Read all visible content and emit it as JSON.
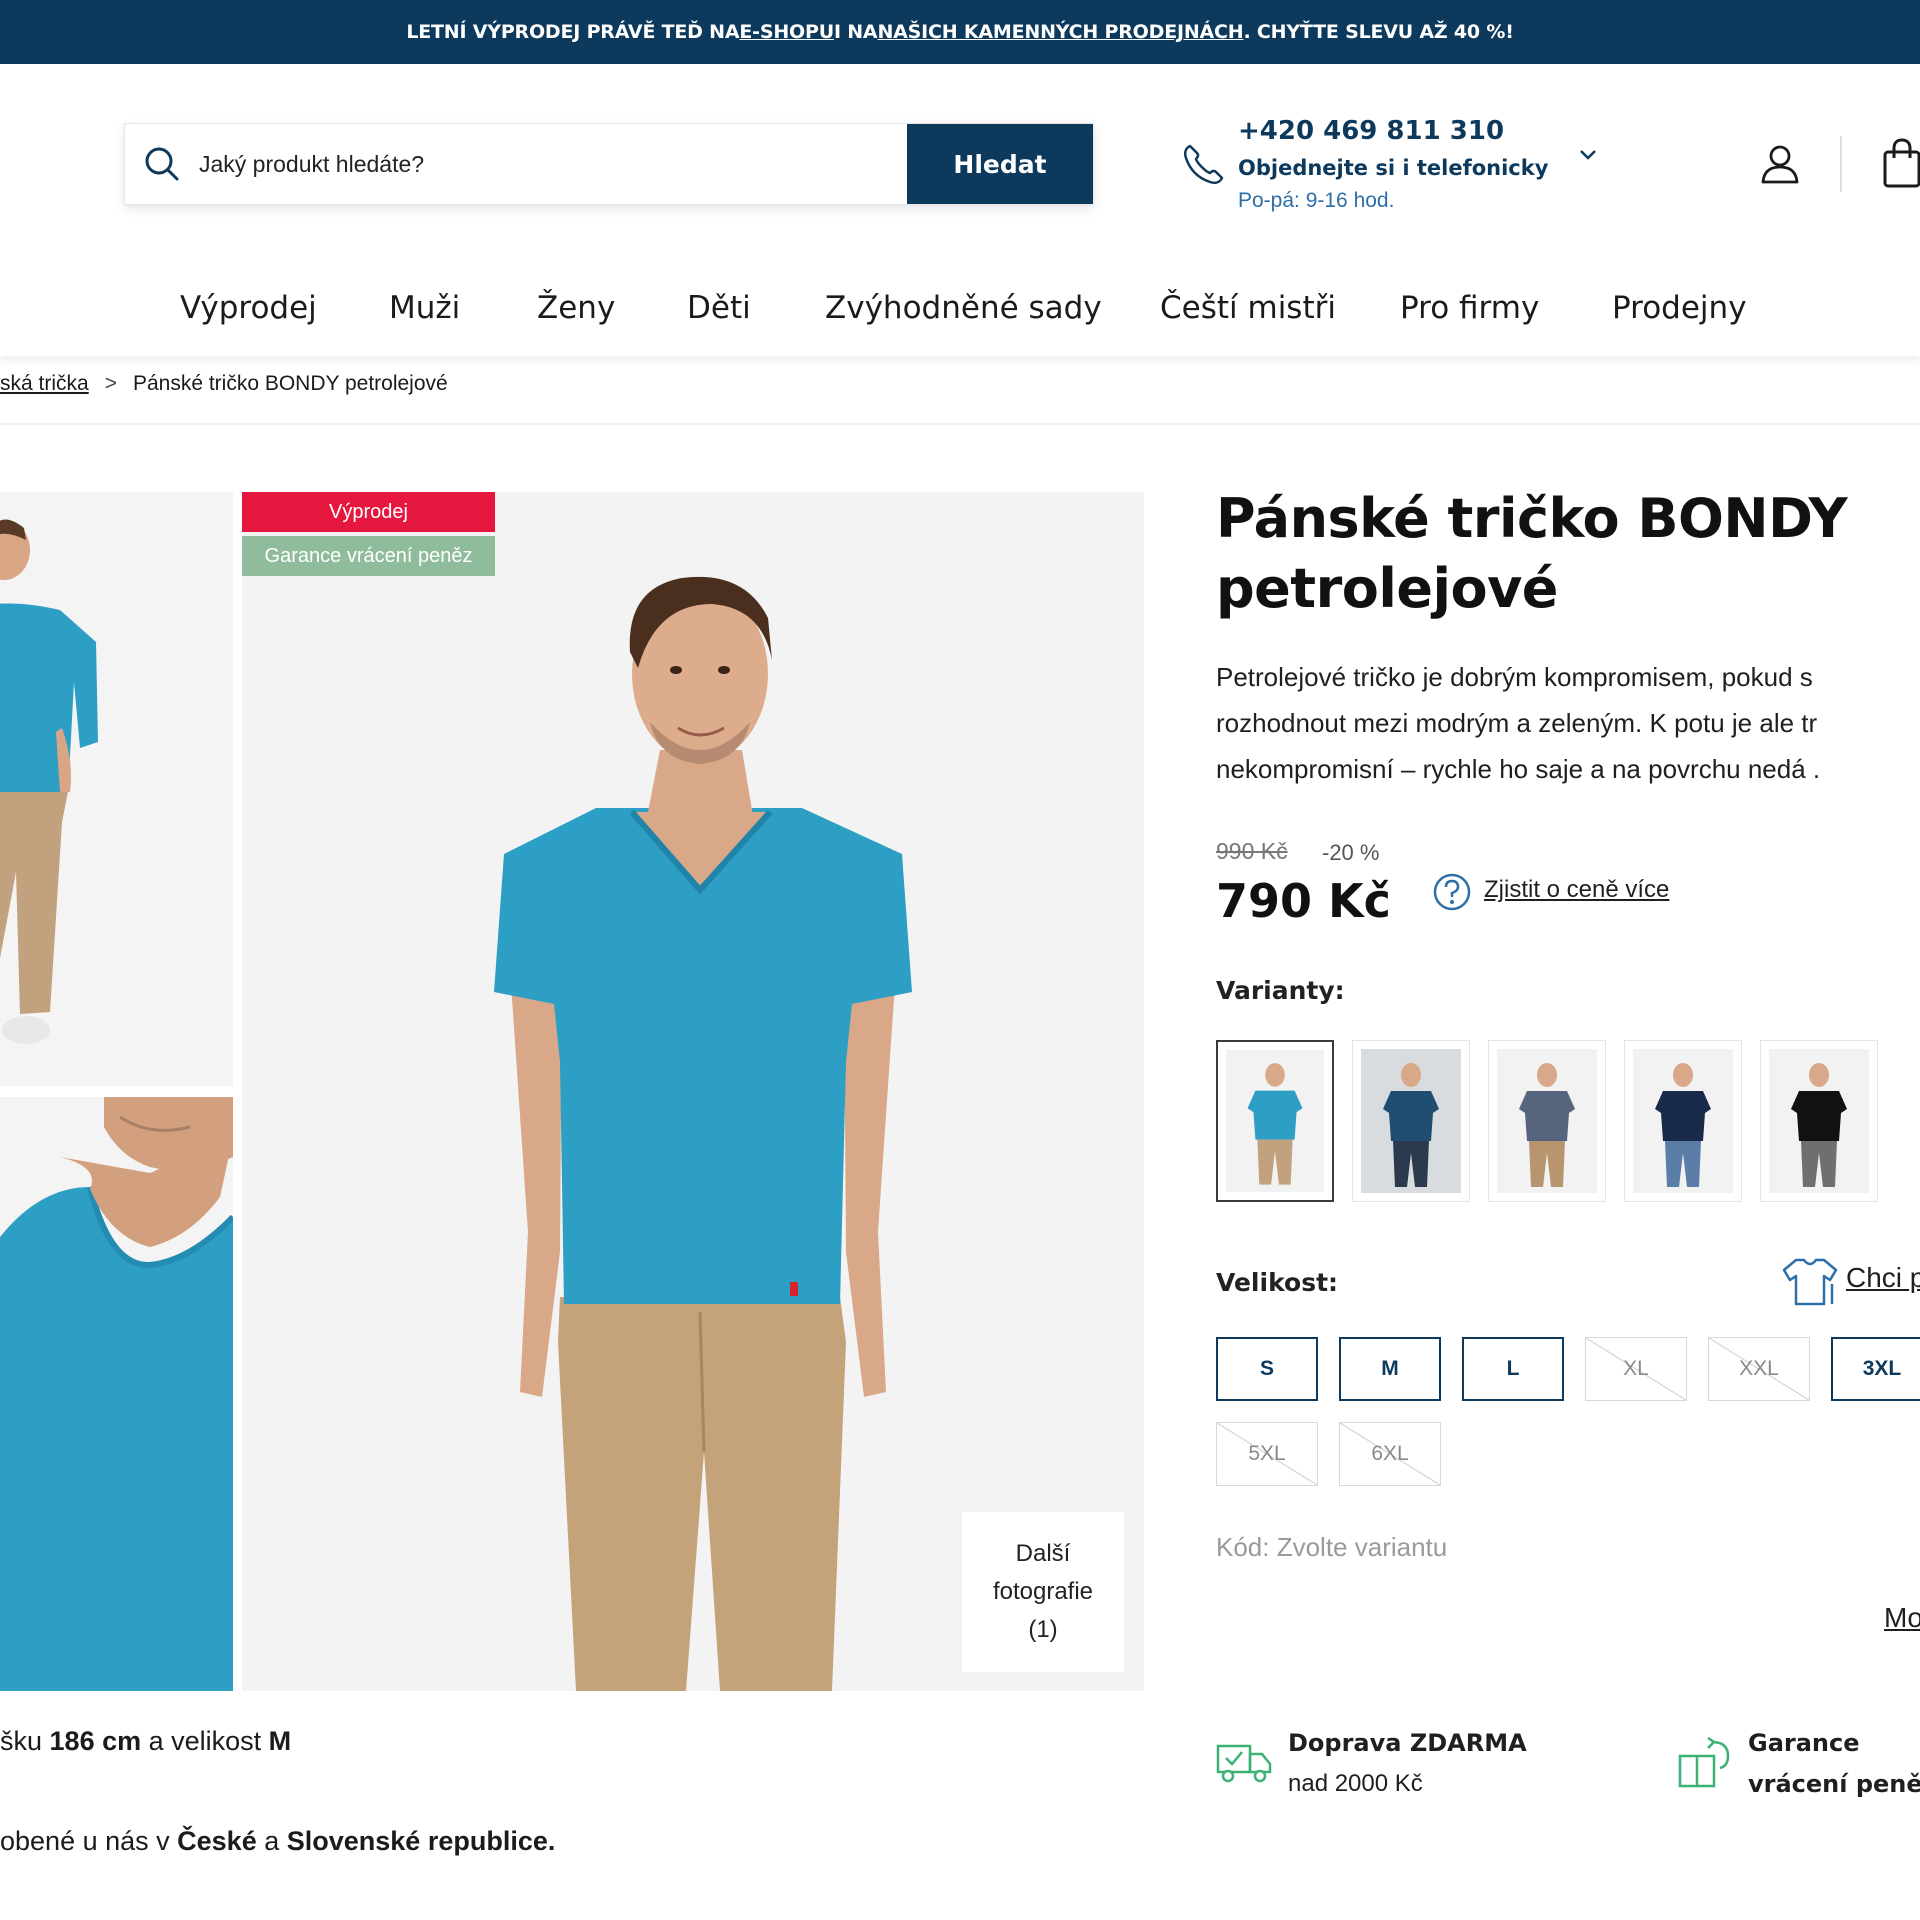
{
  "banner": {
    "text_before": "LETNÍ VÝPRODEJ PRÁVĚ TEĎ NA ",
    "link1": "E-SHOPU",
    "text_middle": " I NA ",
    "link2": "NAŠICH KAMENNÝCH PRODEJNÁCH",
    "text_after": ". CHYŤTE SLEVU AŽ 40 %!"
  },
  "header": {
    "search_placeholder": "Jaký produkt hledáte?",
    "search_button": "Hledat",
    "phone_number": "+420 469 811 310",
    "phone_subtitle": "Objednejte si i telefonicky",
    "phone_hours": "Po-pá: 9-16 hod."
  },
  "nav": {
    "items": [
      "Výprodej",
      "Muži",
      "Ženy",
      "Děti",
      "Zvýhodněné sady",
      "Čeští mistři",
      "Pro firmy",
      "Prodejny"
    ]
  },
  "breadcrumb": {
    "parent": "ská trička",
    "separator": ">",
    "current": "Pánské tričko BONDY petrolejové"
  },
  "gallery": {
    "badge_sale": "Výprodej",
    "badge_guarantee": "Garance vrácení peněz",
    "more_photos_line1": "Další",
    "more_photos_line2": "fotografie",
    "more_photos_line3": "(1)"
  },
  "model_info": {
    "line1_prefix": "šku ",
    "height": "186 cm",
    "line1_middle": " a velikost ",
    "size": "M",
    "line2_prefix": "obené u nás v ",
    "country1": "České",
    "line2_middle": " a ",
    "country2": "Slovenské republice."
  },
  "product": {
    "title": "Pánské tričko BONDY petrolejové",
    "description_lines": [
      "Petrolejové tričko je dobrým kompromisem, pokud s",
      "rozhodnout mezi modrým a zeleným. K potu je ale tr",
      "nekompromisní – rychle ho saje a na povrchu nedá ."
    ],
    "old_price": "990 Kč",
    "discount": "-20 %",
    "price": "790 Kč",
    "price_info_link": "Zjistit o ceně více",
    "variants_label": "Varianty:",
    "variants": [
      {
        "shirt_color": "#2d9ec4",
        "bg": "#f2f2f2",
        "pants": "#c2a27e",
        "selected": true
      },
      {
        "shirt_color": "#1f4e72",
        "bg": "#d9dcdf",
        "pants": "#2b3a4d",
        "selected": false
      },
      {
        "shirt_color": "#56647e",
        "bg": "#f2f2f2",
        "pants": "#b8956e",
        "selected": false
      },
      {
        "shirt_color": "#1a2a4a",
        "bg": "#f2f2f2",
        "pants": "#5a7ea8",
        "selected": false
      },
      {
        "shirt_color": "#111111",
        "bg": "#f2f2f2",
        "pants": "#6f6f6f",
        "selected": false
      }
    ],
    "size_label": "Velikost:",
    "size_guide_link": "Chci p",
    "sizes": [
      {
        "label": "S",
        "available": true
      },
      {
        "label": "M",
        "available": true
      },
      {
        "label": "L",
        "available": true
      },
      {
        "label": "XL",
        "available": false
      },
      {
        "label": "XXL",
        "available": false
      },
      {
        "label": "3XL",
        "available": true
      },
      {
        "label": "5XL",
        "available": false
      },
      {
        "label": "6XL",
        "available": false
      }
    ],
    "code_text": "Kód: Zvolte variantu",
    "more_link": "Mo"
  },
  "perks": {
    "shipping_title": "Doprava ZDARMA",
    "shipping_sub": "nad 2000 Kč",
    "guarantee_title": "Garance",
    "guarantee_sub": "vrácení peněz"
  },
  "colors": {
    "brand_navy": "#0d3a5c",
    "sale_red": "#e5173f",
    "guarantee_green": "#8fbc9a",
    "shirt_petrol": "#2d9ec4"
  }
}
